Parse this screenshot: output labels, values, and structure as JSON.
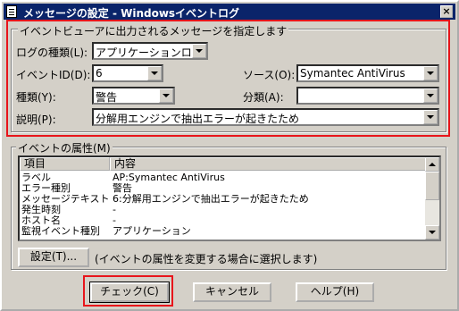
{
  "window": {
    "title": "メッセージの設定 - Windowsイベントログ"
  },
  "section1": {
    "title": "イベントビューアに出力されるメッセージを指定します",
    "log_type_label": "ログの種類(L):",
    "log_type_value": "アプリケーションログ",
    "event_id_label": "イベントID(D):",
    "event_id_value": "6",
    "source_label": "ソース(O):",
    "source_value": "Symantec AntiVirus",
    "type_label": "種類(Y):",
    "type_value": "警告",
    "category_label": "分類(A):",
    "category_value": "",
    "description_label": "説明(P):",
    "description_value": "分解用エンジンで抽出エラーが起きたため"
  },
  "section2": {
    "title": "イベントの属性(M)",
    "columns": [
      "項目",
      "内容"
    ],
    "rows": [
      {
        "item": "ラベル",
        "value": "AP:Symantec AntiVirus"
      },
      {
        "item": "エラー種別",
        "value": "警告"
      },
      {
        "item": "メッセージテキスト",
        "value": "6:分解用エンジンで抽出エラーが起きたため"
      },
      {
        "item": "発生時刻",
        "value": "-"
      },
      {
        "item": "ホスト名",
        "value": "-"
      },
      {
        "item": "監視イベント種別",
        "value": "アプリケーション"
      }
    ],
    "settings_button": "設定(T)...",
    "settings_hint": "(イベントの属性を変更する場合に選択します)"
  },
  "buttons": {
    "check": "チェック(C)",
    "cancel": "キャンセル",
    "help": "ヘルプ(H)"
  },
  "colors": {
    "titlebar": "#0a246a",
    "highlight_box": "#e8151b",
    "dialog_bg": "#d4d0c8"
  }
}
